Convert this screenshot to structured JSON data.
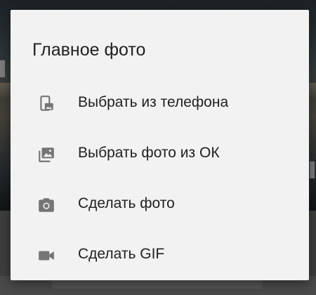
{
  "dialog": {
    "title": "Главное фото",
    "items": [
      {
        "label": "Выбрать из телефона",
        "icon": "phone-photo-icon"
      },
      {
        "label": "Выбрать фото из ОК",
        "icon": "photo-library-icon"
      },
      {
        "label": "Сделать фото",
        "icon": "camera-icon"
      },
      {
        "label": "Сделать GIF",
        "icon": "videocam-icon"
      }
    ]
  },
  "colors": {
    "dialog_background": "#f2f2f2",
    "text": "#212121",
    "icon": "#757575",
    "scrim": "#2b2b2b"
  }
}
